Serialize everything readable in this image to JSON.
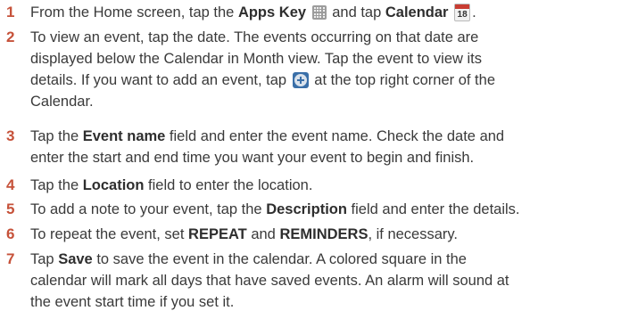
{
  "steps": [
    {
      "number": "1",
      "t1": "From the Home screen, tap the ",
      "b1": "Apps Key",
      "t2": " and tap ",
      "b2": "Calendar",
      "t3": "."
    },
    {
      "number": "2",
      "lines": [
        "To view an event, tap the date. The events occurring on that date are",
        "displayed below the Calendar in Month view. Tap the event to view its"
      ],
      "l3a": "details. If you want to add an event, tap ",
      "l3b": " at the top right corner of the",
      "l4": "Calendar."
    },
    {
      "number": "3",
      "t1": "Tap the ",
      "b1": "Event name",
      "t2": " field and enter the event name. Check the date and",
      "l2": "enter the start and end time you want your event to begin and finish."
    },
    {
      "number": "4",
      "t1": "Tap the ",
      "b1": "Location",
      "t2": " field to enter the location."
    },
    {
      "number": "5",
      "t1": "To add a note to your event, tap the ",
      "b1": "Description",
      "t2": " field and enter the details."
    },
    {
      "number": "6",
      "t1": "To repeat the event, set ",
      "b1": "REPEAT",
      "t2": " and ",
      "b2": "REMINDERS",
      "t3": ", if necessary."
    },
    {
      "number": "7",
      "t1": "Tap ",
      "b1": "Save",
      "t2": " to save the event in the calendar. A colored square in the",
      "l2": "calendar will mark all days that have saved events. An alarm will sound at",
      "l3": "the event start time if you set it."
    }
  ],
  "icons": {
    "apps": "apps-key-icon",
    "calendar": "calendar-app-icon",
    "calendar_day": "18",
    "add": "add-event-icon"
  },
  "colors": {
    "step_number": "#c6523a",
    "text": "#3a3a3a",
    "calendar_header": "#c83c32",
    "add_icon": "#3a6fa8"
  }
}
